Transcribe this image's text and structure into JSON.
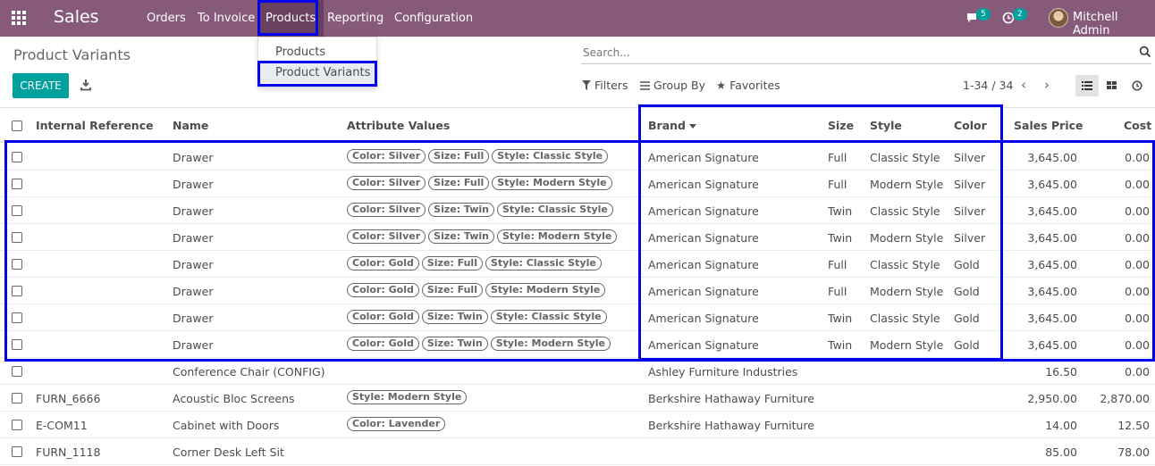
{
  "navbar": {
    "app_title": "Sales",
    "menus": [
      "Orders",
      "To Invoice",
      "Products",
      "Reporting",
      "Configuration"
    ],
    "messages_count": "5",
    "activities_count": "2",
    "user_name": "Mitchell Admin"
  },
  "products_menu": {
    "items": [
      "Products",
      "Product Variants"
    ]
  },
  "control_panel": {
    "breadcrumb": "Product Variants",
    "search_placeholder": "Search...",
    "create_label": "CREATE",
    "filters_label": "Filters",
    "groupby_label": "Group By",
    "favorites_label": "Favorites",
    "pager": "1-34 / 34"
  },
  "table": {
    "headers": {
      "internal_reference": "Internal Reference",
      "name": "Name",
      "attribute_values": "Attribute Values",
      "brand": "Brand",
      "size": "Size",
      "style": "Style",
      "color": "Color",
      "sales_price": "Sales Price",
      "cost": "Cost"
    },
    "rows": [
      {
        "ref": "",
        "name": "Drawer",
        "tags": [
          "Color: Silver",
          "Size: Full",
          "Style: Classic Style"
        ],
        "brand": "American Signature",
        "size": "Full",
        "style": "Classic Style",
        "color": "Silver",
        "price": "3,645.00",
        "cost": "0.00"
      },
      {
        "ref": "",
        "name": "Drawer",
        "tags": [
          "Color: Silver",
          "Size: Full",
          "Style: Modern Style"
        ],
        "brand": "American Signature",
        "size": "Full",
        "style": "Modern Style",
        "color": "Silver",
        "price": "3,645.00",
        "cost": "0.00"
      },
      {
        "ref": "",
        "name": "Drawer",
        "tags": [
          "Color: Silver",
          "Size: Twin",
          "Style: Classic Style"
        ],
        "brand": "American Signature",
        "size": "Twin",
        "style": "Classic Style",
        "color": "Silver",
        "price": "3,645.00",
        "cost": "0.00"
      },
      {
        "ref": "",
        "name": "Drawer",
        "tags": [
          "Color: Silver",
          "Size: Twin",
          "Style: Modern Style"
        ],
        "brand": "American Signature",
        "size": "Twin",
        "style": "Modern Style",
        "color": "Silver",
        "price": "3,645.00",
        "cost": "0.00"
      },
      {
        "ref": "",
        "name": "Drawer",
        "tags": [
          "Color: Gold",
          "Size: Full",
          "Style: Classic Style"
        ],
        "brand": "American Signature",
        "size": "Full",
        "style": "Classic Style",
        "color": "Gold",
        "price": "3,645.00",
        "cost": "0.00"
      },
      {
        "ref": "",
        "name": "Drawer",
        "tags": [
          "Color: Gold",
          "Size: Full",
          "Style: Modern Style"
        ],
        "brand": "American Signature",
        "size": "Full",
        "style": "Modern Style",
        "color": "Gold",
        "price": "3,645.00",
        "cost": "0.00"
      },
      {
        "ref": "",
        "name": "Drawer",
        "tags": [
          "Color: Gold",
          "Size: Twin",
          "Style: Classic Style"
        ],
        "brand": "American Signature",
        "size": "Twin",
        "style": "Classic Style",
        "color": "Gold",
        "price": "3,645.00",
        "cost": "0.00"
      },
      {
        "ref": "",
        "name": "Drawer",
        "tags": [
          "Color: Gold",
          "Size: Twin",
          "Style: Modern Style"
        ],
        "brand": "American Signature",
        "size": "Twin",
        "style": "Modern Style",
        "color": "Gold",
        "price": "3,645.00",
        "cost": "0.00"
      },
      {
        "ref": "",
        "name": "Conference Chair (CONFIG)",
        "tags": [],
        "brand": "Ashley Furniture Industries",
        "size": "",
        "style": "",
        "color": "",
        "price": "16.50",
        "cost": "0.00"
      },
      {
        "ref": "FURN_6666",
        "name": "Acoustic Bloc Screens",
        "tags": [
          "Style: Modern Style"
        ],
        "brand": "Berkshire Hathaway Furniture",
        "size": "",
        "style": "",
        "color": "",
        "price": "2,950.00",
        "cost": "2,870.00"
      },
      {
        "ref": "E-COM11",
        "name": "Cabinet with Doors",
        "tags": [
          "Color: Lavender"
        ],
        "brand": "Berkshire Hathaway Furniture",
        "size": "",
        "style": "",
        "color": "",
        "price": "14.00",
        "cost": "12.50"
      },
      {
        "ref": "FURN_1118",
        "name": "Corner Desk Left Sit",
        "tags": [],
        "brand": "",
        "size": "",
        "style": "",
        "color": "",
        "price": "85.00",
        "cost": "78.00"
      }
    ]
  },
  "colors": {
    "navbar": "#875a7b",
    "primary_button": "#00a09d",
    "highlight": "#0000ee"
  }
}
